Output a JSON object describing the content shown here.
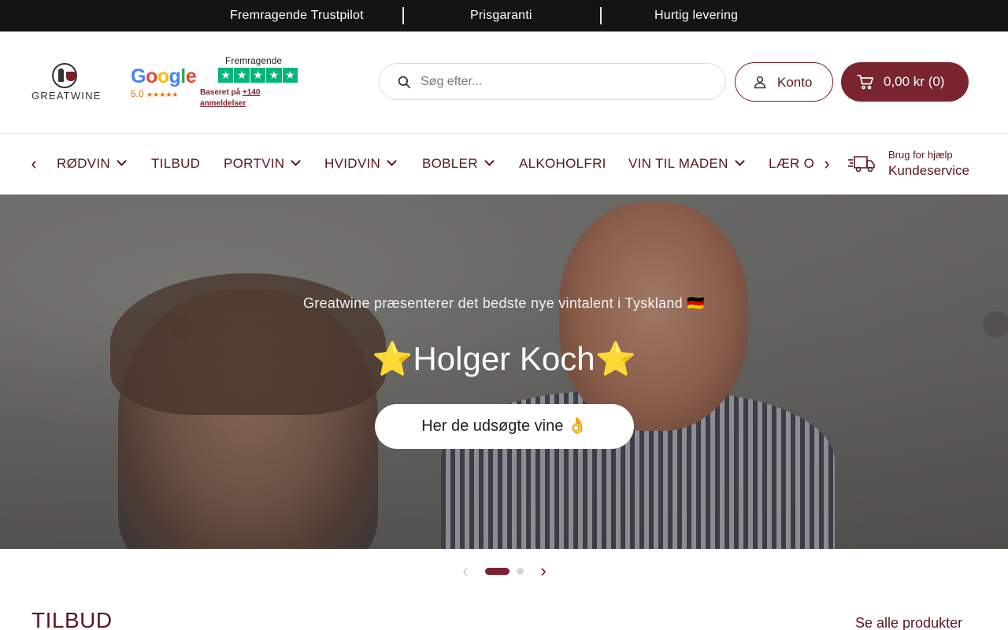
{
  "topbar": {
    "usps": [
      "Fremragende Trustpilot",
      "Prisgaranti",
      "Hurtig levering"
    ]
  },
  "header": {
    "logo_text": "GREATWINE",
    "google": {
      "rating": "5.0",
      "stars": "★★★★★"
    },
    "trustpilot": {
      "title": "Fremragende",
      "based_prefix": "Baseret på ",
      "based_count": "+140 anmeldelser"
    },
    "search": {
      "placeholder": "Søg efter..."
    },
    "account_label": "Konto",
    "cart_label": "0,00 kr (0)"
  },
  "nav": {
    "items": [
      {
        "label": "Rødvin",
        "dropdown": true
      },
      {
        "label": "Tilbud",
        "dropdown": false
      },
      {
        "label": "Portvin",
        "dropdown": true
      },
      {
        "label": "Hvidvin",
        "dropdown": true
      },
      {
        "label": "Bobler",
        "dropdown": true
      },
      {
        "label": "Alkoholfri",
        "dropdown": false
      },
      {
        "label": "Vin til maden",
        "dropdown": true
      },
      {
        "label": "Lær om vin",
        "dropdown": false
      }
    ],
    "help_small": "Brug for hjælp",
    "help_big": "Kundeservice"
  },
  "hero": {
    "subtitle": "Greatwine præsenterer det bedste nye vintalent i Tyskland 🇩🇪",
    "title": "⭐Holger Koch⭐",
    "cta": "Her de udsøgte vine 👌"
  },
  "slider": {
    "slides": 2,
    "active": 1
  },
  "section": {
    "title": "TILBUD",
    "link": "Se alle produkter"
  },
  "colors": {
    "brand": "#7a2430",
    "topbar": "#141414",
    "trustpilot": "#00b67a"
  }
}
